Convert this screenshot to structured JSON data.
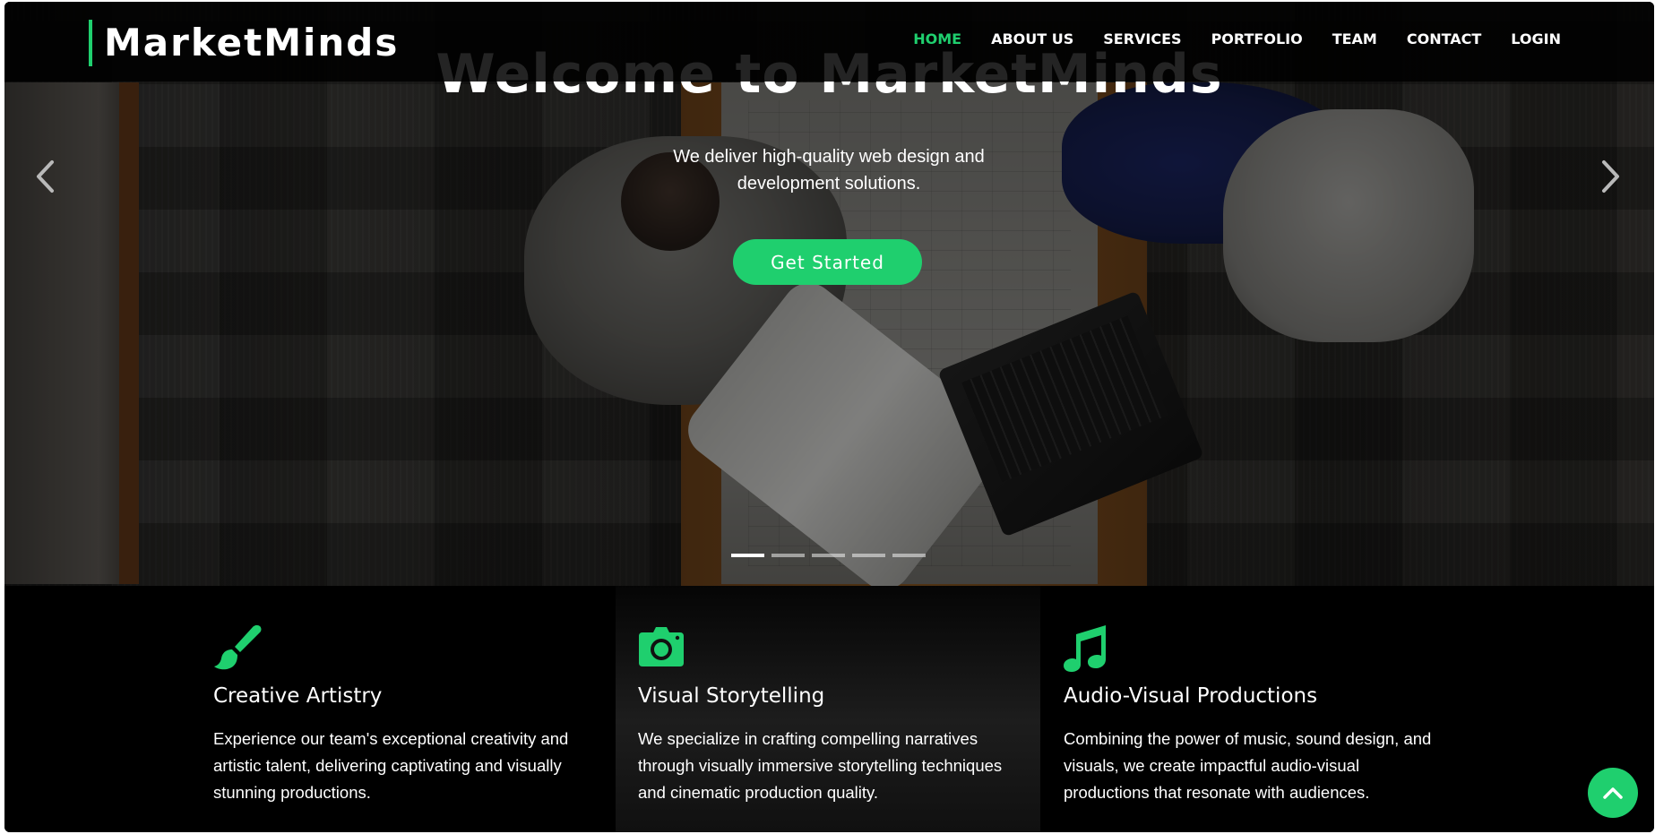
{
  "brand": {
    "name": "MarketMinds",
    "accent_color": "#1fcf6e"
  },
  "nav": {
    "items": [
      {
        "label": "HOME",
        "active": true
      },
      {
        "label": "ABOUT US",
        "active": false
      },
      {
        "label": "SERVICES",
        "active": false
      },
      {
        "label": "PORTFOLIO",
        "active": false
      },
      {
        "label": "TEAM",
        "active": false
      },
      {
        "label": "CONTACT",
        "active": false
      },
      {
        "label": "LOGIN",
        "active": false
      }
    ]
  },
  "hero": {
    "title": "Welcome to MarketMinds",
    "subtitle": "We deliver high-quality web design and development solutions.",
    "cta_label": "Get Started",
    "prev_icon": "chevron-left-icon",
    "next_icon": "chevron-right-icon",
    "slides_count": 5,
    "active_slide": 1
  },
  "features": [
    {
      "icon": "paint-brush-icon",
      "title": "Creative Artistry",
      "description": "Experience our team's exceptional creativity and artistic talent, delivering captivating and visually stunning productions."
    },
    {
      "icon": "camera-icon",
      "title": "Visual Storytelling",
      "description": "We specialize in crafting compelling narratives through visually immersive storytelling techniques and cinematic production quality."
    },
    {
      "icon": "music-note-icon",
      "title": "Audio-Visual Productions",
      "description": "Combining the power of music, sound design, and visuals, we create impactful audio-visual productions that resonate with audiences."
    }
  ],
  "back_to_top": {
    "icon": "chevron-up-icon"
  }
}
